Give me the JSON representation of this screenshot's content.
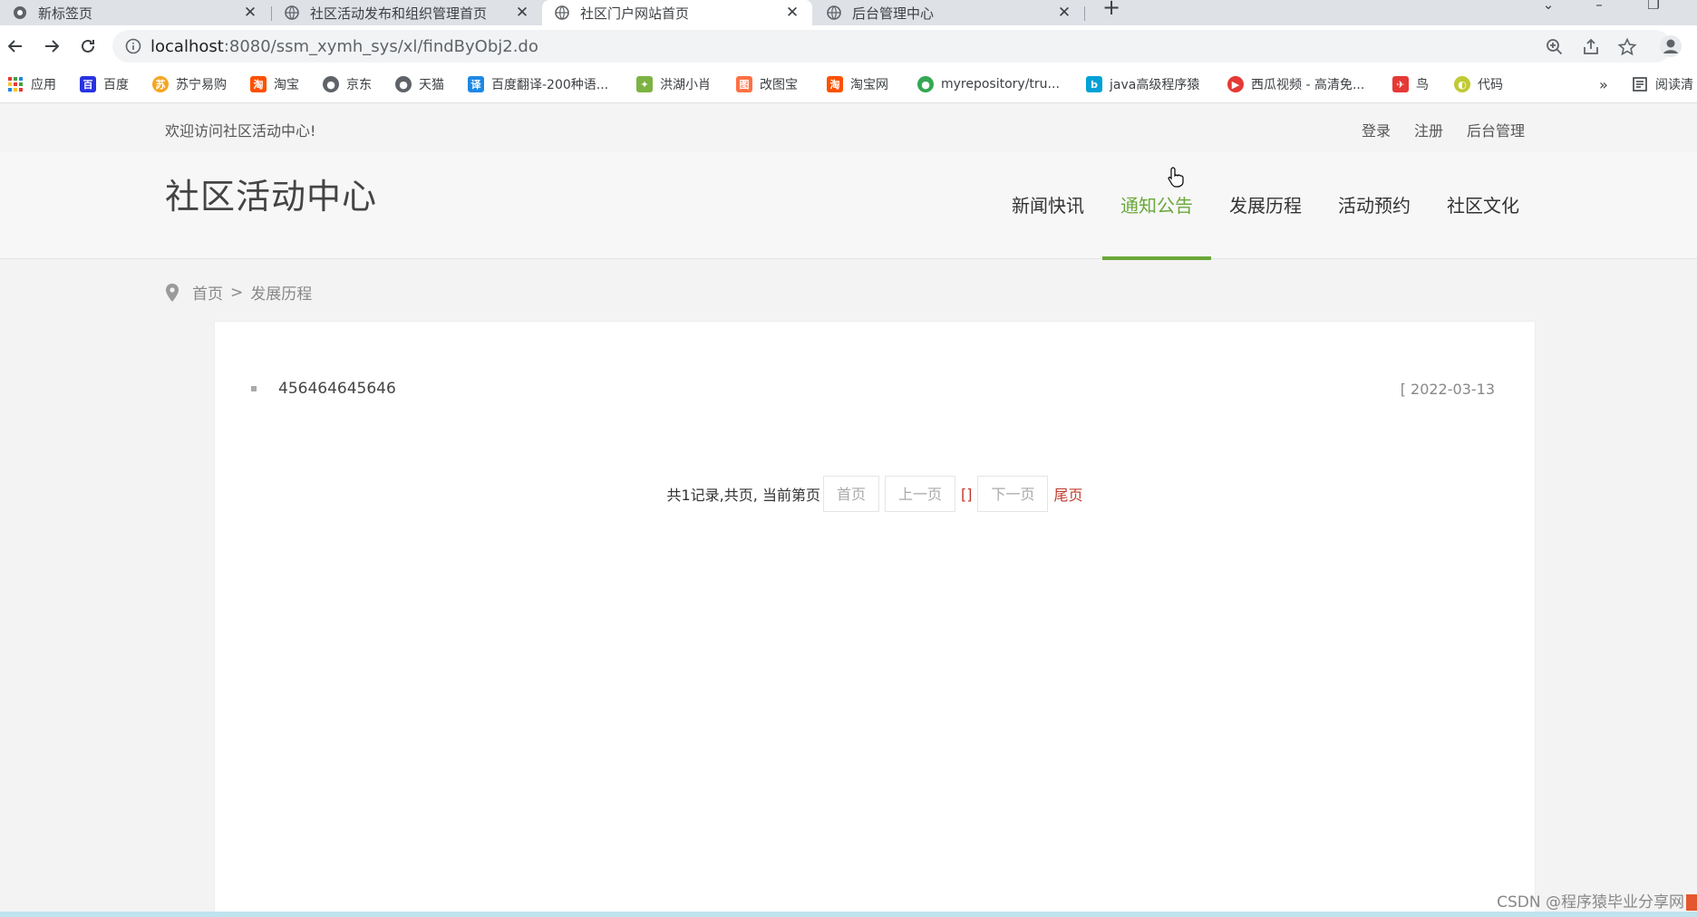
{
  "browser": {
    "tabs": [
      {
        "title": "新标签页"
      },
      {
        "title": "社区活动发布和组织管理首页"
      },
      {
        "title": "社区门户网站首页"
      },
      {
        "title": "后台管理中心"
      }
    ],
    "active_tab_index": 2,
    "close_glyph": "✕",
    "newtab_glyph": "+",
    "url_host": "localhost",
    "url_path": ":8080/ssm_xymh_sys/xl/findByObj2.do",
    "bookmarks": [
      {
        "label": "应用",
        "icon": "apps-icon",
        "color": "#e53935"
      },
      {
        "label": "百度",
        "icon": "baidu-icon",
        "color": "#2932e1"
      },
      {
        "label": "苏宁易购",
        "icon": "suning-icon",
        "color": "#f5a623"
      },
      {
        "label": "淘宝",
        "icon": "taobao-icon",
        "color": "#ff5000"
      },
      {
        "label": "京东",
        "icon": "globe-icon",
        "color": "#5f6368"
      },
      {
        "label": "天猫",
        "icon": "globe-icon",
        "color": "#5f6368"
      },
      {
        "label": "百度翻译-200种语...",
        "icon": "translate-icon",
        "color": "#1e88e5"
      },
      {
        "label": "洪湖小肖",
        "icon": "bird-icon",
        "color": "#7cb342"
      },
      {
        "label": "改图宝",
        "icon": "gaitubao-icon",
        "color": "#ff7043"
      },
      {
        "label": "淘宝网",
        "icon": "taobao-icon",
        "color": "#ff5000"
      },
      {
        "label": "myrepository/tru...",
        "icon": "chrome-icon",
        "color": "#34a853"
      },
      {
        "label": "java高级程序猿",
        "icon": "bilibili-icon",
        "color": "#00a1d6"
      },
      {
        "label": "西瓜视频 - 高清免...",
        "icon": "xigua-icon",
        "color": "#e53935"
      },
      {
        "label": "鸟",
        "icon": "bird-icon",
        "color": "#e53935"
      },
      {
        "label": "代码",
        "icon": "code-icon",
        "color": "#c0ca33"
      }
    ],
    "bookmarks_overflow": "»",
    "reading_list": "阅读清"
  },
  "site": {
    "welcome": "欢迎访问社区活动中心!",
    "top_links": {
      "login": "登录",
      "register": "注册",
      "admin": "后台管理"
    },
    "logo": "社区活动中心",
    "nav": [
      {
        "label": "新闻快讯"
      },
      {
        "label": "通知公告"
      },
      {
        "label": "发展历程"
      },
      {
        "label": "活动预约"
      },
      {
        "label": "社区文化"
      }
    ],
    "active_nav_index": 1,
    "accent_color": "#6aa83a",
    "breadcrumb": {
      "home": "首页",
      "separator": ">",
      "current": "发展历程"
    },
    "items": [
      {
        "title": "456464645646",
        "date": "[ 2022-03-13"
      }
    ],
    "pager": {
      "summary": "共1记录,共页, 当前第页",
      "first": "首页",
      "prev": "上一页",
      "brackets": "[]",
      "next": "下一页",
      "last": "尾页"
    },
    "watermark": "CSDN @程序猿毕业分享网"
  }
}
